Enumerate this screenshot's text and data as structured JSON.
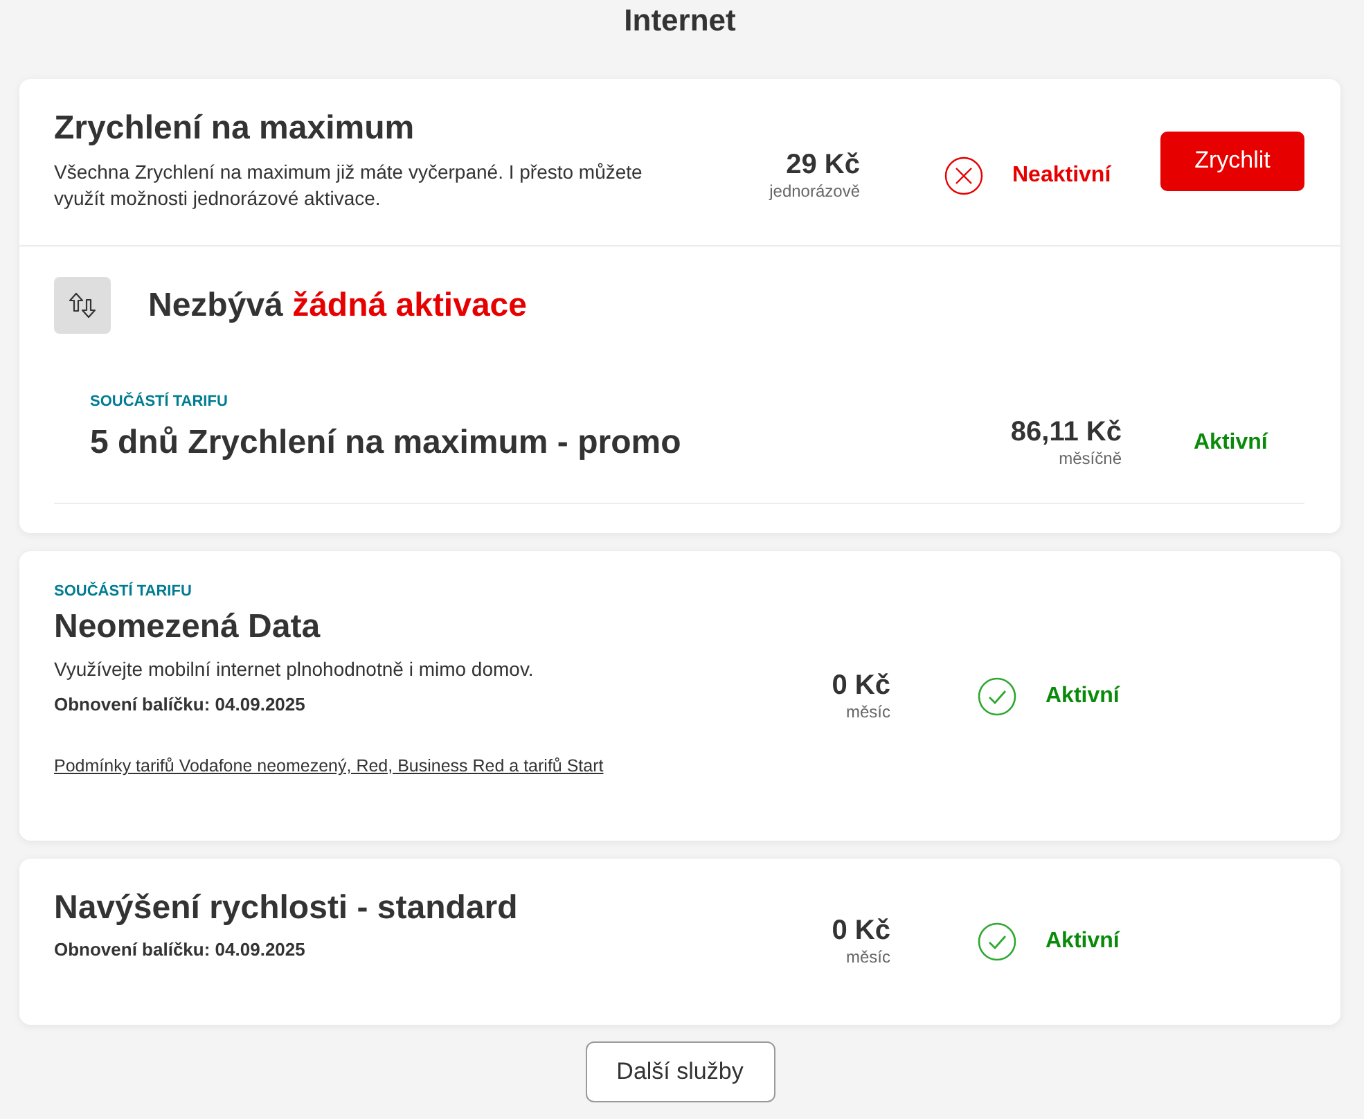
{
  "page_title": "Internet",
  "cards": [
    {
      "kind": "offer",
      "title": "Zrychlení na maximum",
      "description": "Všechna Zrychlení na maximum již máte vyčerpané. I přesto můžete využít možnosti jednorázové aktivace.",
      "price": "29 Kč",
      "price_note": "jednorázově",
      "status": {
        "label": "Neaktivní",
        "active": false
      },
      "action": "Zrychlit",
      "notice": {
        "text": "Nezbývá",
        "highlight": "žádná aktivace"
      },
      "included": [
        {
          "tag": "SOUČÁSTÍ TARIFU",
          "title": "5 dnů Zrychlení na maximum - promo",
          "price": "86,11 Kč",
          "price_note": "měsíčně",
          "status": {
            "label": "Aktivní",
            "active": true
          }
        }
      ]
    },
    {
      "kind": "package",
      "tag": "SOUČÁSTÍ TARIFU",
      "title": "Neomezená Data",
      "description": "Využívejte mobilní internet plnohodnotně i mimo domov.",
      "renewal": "Obnovení balíčku: 04.09.2025",
      "link": "Podmínky tarifů Vodafone neomezený, Red, Business Red a tarifů Start",
      "price": "0 Kč",
      "price_note": "měsíc",
      "status": {
        "label": "Aktivní",
        "active": true
      }
    },
    {
      "kind": "package",
      "title": "Navýšení rychlosti - standard",
      "renewal": "Obnovení balíčku: 04.09.2025",
      "price": "0 Kč",
      "price_note": "měsíc",
      "status": {
        "label": "Aktivní",
        "active": true
      }
    }
  ],
  "more_button": "Další služby"
}
